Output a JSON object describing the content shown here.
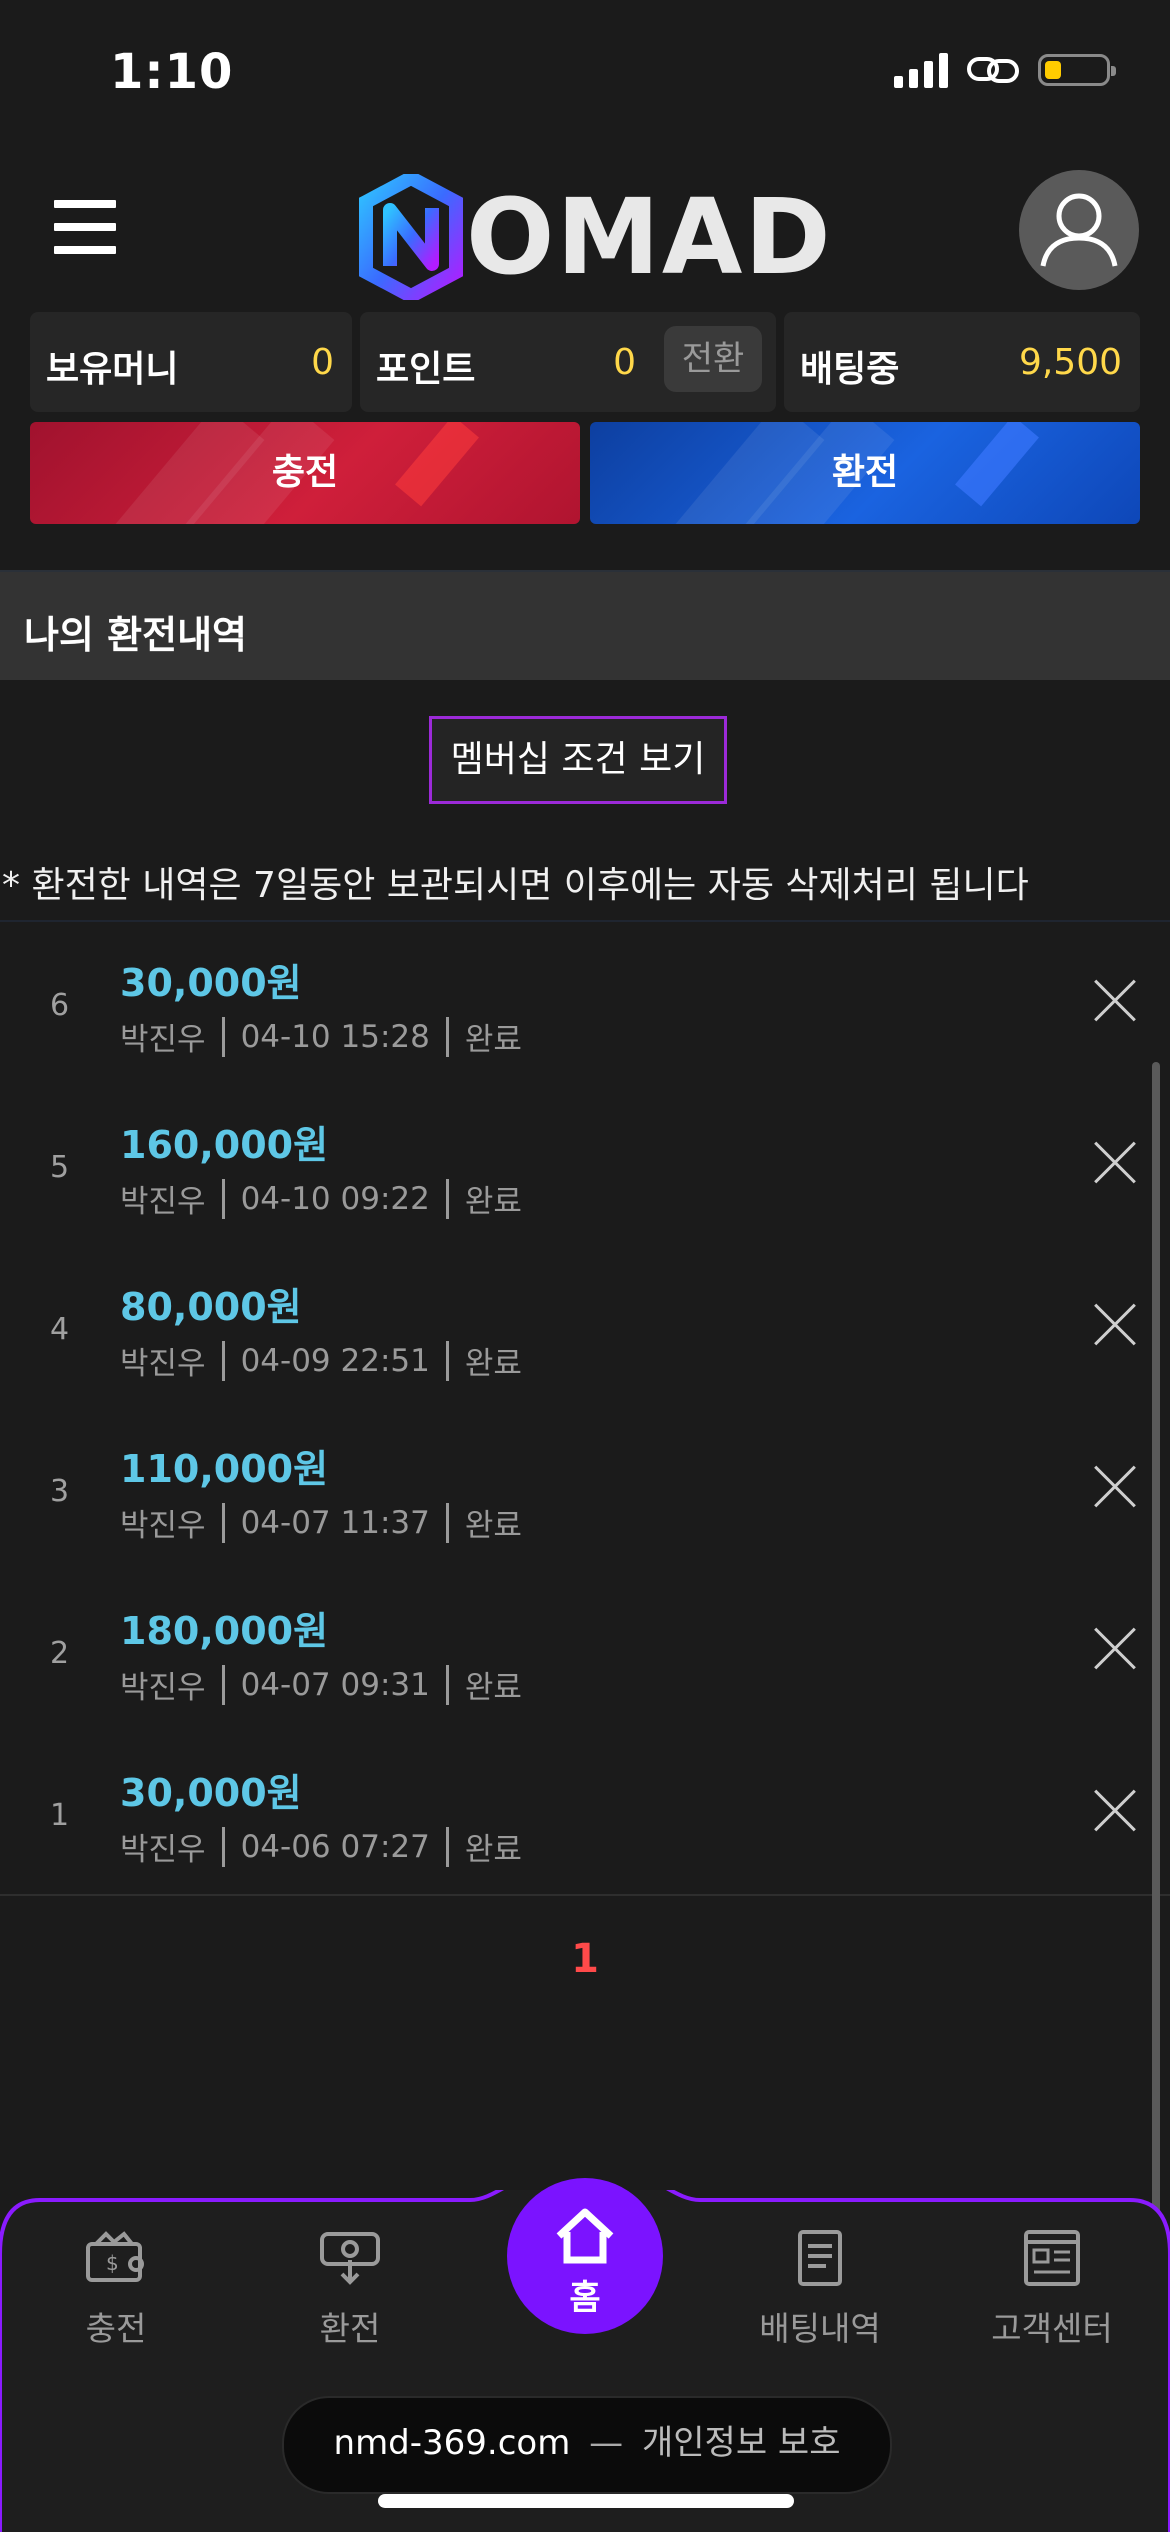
{
  "status_bar": {
    "time": "1:10",
    "battery_level": 0.2,
    "battery_color": "#ffcc00"
  },
  "header": {
    "logo_text": "OMAD",
    "menu_icon": "hamburger-menu-icon",
    "avatar_icon": "user-icon"
  },
  "balances": [
    {
      "label": "보유머니",
      "value": "0"
    },
    {
      "label": "포인트",
      "value": "0",
      "action": "전환"
    },
    {
      "label": "배팅중",
      "value": "9,500"
    }
  ],
  "actions": {
    "deposit": "충전",
    "withdraw": "환전"
  },
  "section": {
    "title": "나의 환전내역"
  },
  "membership_button": "멤버십 조건 보기",
  "notice": "* 환전한 내역은 7일동안 보관되시면 이후에는 자동 삭제처리 됩니다",
  "history": [
    {
      "index": "6",
      "amount": "30,000원",
      "name": "박진우",
      "datetime": "04-10 15:28",
      "status": "완료"
    },
    {
      "index": "5",
      "amount": "160,000원",
      "name": "박진우",
      "datetime": "04-10 09:22",
      "status": "완료"
    },
    {
      "index": "4",
      "amount": "80,000원",
      "name": "박진우",
      "datetime": "04-09 22:51",
      "status": "완료"
    },
    {
      "index": "3",
      "amount": "110,000원",
      "name": "박진우",
      "datetime": "04-07 11:37",
      "status": "완료"
    },
    {
      "index": "2",
      "amount": "180,000원",
      "name": "박진우",
      "datetime": "04-07 09:31",
      "status": "완료"
    },
    {
      "index": "1",
      "amount": "30,000원",
      "name": "박진우",
      "datetime": "04-06 07:27",
      "status": "완료"
    }
  ],
  "pagination": {
    "current": "1"
  },
  "bottom_nav": {
    "deposit": "충전",
    "withdraw": "환전",
    "home": "홈",
    "betting_history": "배팅내역",
    "support": "고객센터"
  },
  "browser": {
    "host": "nmd-369.com",
    "separator": "—",
    "privacy": "개인정보 보호"
  },
  "colors": {
    "accent": "#7b13ff",
    "amount": "#5ec7e6",
    "balance": "#ffd84a",
    "page": "#ff4a4a"
  }
}
